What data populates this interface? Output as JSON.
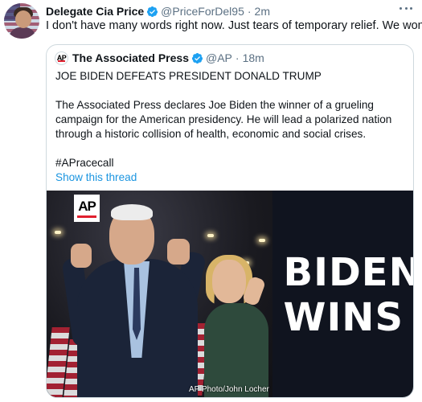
{
  "tweet": {
    "display_name": "Delegate Cia Price",
    "handle": "@PriceForDel95",
    "separator": "·",
    "time": "2m",
    "text": "I don't have many words right now. Just tears of temporary relief. We won!!!!",
    "verified": true,
    "avatar_icon": "user-avatar"
  },
  "quote": {
    "display_name": "The Associated Press",
    "handle": "@AP",
    "separator": "·",
    "time": "18m",
    "verified": true,
    "headline": "JOE BIDEN DEFEATS PRESIDENT DONALD TRUMP",
    "body": "The Associated Press declares Joe Biden the winner of a grueling campaign for the American presidency. He will lead a polarized nation through a historic collision of health, economic and social crises.",
    "hashtag": "#APracecall",
    "show_thread": "Show this thread",
    "image": {
      "logo_text": "AP",
      "credit": "AP Photo/John Locher",
      "headline_line1": "BIDEN",
      "headline_line2": "WINS"
    }
  },
  "colors": {
    "link": "#1b95e0",
    "verified": "#1da1f2",
    "secondary_text": "#5b7083",
    "panel_bg": "#10141f",
    "ap_red": "#e0202e"
  }
}
